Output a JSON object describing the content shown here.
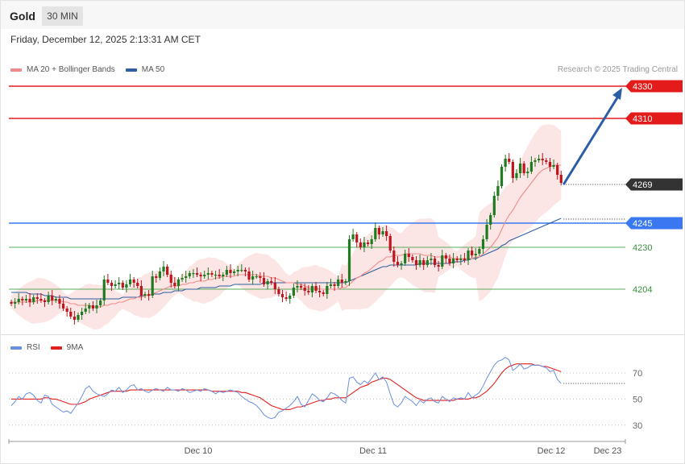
{
  "header": {
    "title": "Gold",
    "timeframe": "30 MIN",
    "datetime": "Friday, December 12, 2025 2:13:31 AM CET",
    "credit": "Research © 2025 Trading Central"
  },
  "colors": {
    "bullish": "#1e7b1e",
    "bearish": "#c0141c",
    "resistance": "#e31b1b",
    "pivot": "#3a78f2",
    "support": "#5aac5a",
    "bollinger": "#fbdcdc",
    "ma20": "#f08a8a",
    "ma50": "#2f5e9e",
    "last_price": "#333333",
    "arrow": "#2b5ea7",
    "rsi": "#6b8fe0",
    "rsi_ma": "#e21f1f"
  },
  "chart_data": [
    {
      "type": "candlestick",
      "title": "Gold",
      "timeframe": "30 MIN",
      "ylim": [
        4185,
        4340
      ],
      "x_tick_labels": [
        "Dec 10",
        "Dec 11",
        "Dec 12",
        "Dec 23"
      ],
      "legend": [
        {
          "name": "MA 20 + Bollinger Bands",
          "color": "#f08a8a"
        },
        {
          "name": "MA 50",
          "color": "#2f5e9e"
        }
      ],
      "legend_position": "top-left",
      "last_price": 4269,
      "levels": [
        {
          "label": "4330",
          "value": 4330,
          "kind": "resistance",
          "color": "#e31b1b"
        },
        {
          "label": "4310",
          "value": 4310,
          "kind": "resistance",
          "color": "#e31b1b"
        },
        {
          "label": "4245",
          "value": 4245,
          "kind": "pivot",
          "color": "#3a78f2"
        },
        {
          "label": "4230",
          "value": 4230,
          "kind": "support",
          "color": "#5aac5a"
        },
        {
          "label": "4204",
          "value": 4204,
          "kind": "support",
          "color": "#5aac5a"
        }
      ],
      "projection": {
        "from": 4269,
        "to": 4330,
        "color": "#2b5ea7"
      },
      "closes": [
        4195,
        4196,
        4198,
        4197,
        4198,
        4196,
        4199,
        4198,
        4197,
        4196,
        4200,
        4197,
        4198,
        4195,
        4192,
        4190,
        4187,
        4185,
        4188,
        4190,
        4192,
        4194,
        4192,
        4194,
        4197,
        4210,
        4208,
        4206,
        4207,
        4208,
        4205,
        4207,
        4210,
        4208,
        4206,
        4200,
        4201,
        4200,
        4212,
        4211,
        4215,
        4218,
        4213,
        4208,
        4206,
        4210,
        4211,
        4212,
        4214,
        4214,
        4213,
        4212,
        4213,
        4214,
        4213,
        4213,
        4212,
        4213,
        4216,
        4214,
        4215,
        4216,
        4216,
        4215,
        4210,
        4212,
        4212,
        4211,
        4207,
        4209,
        4208,
        4204,
        4201,
        4199,
        4198,
        4200,
        4205,
        4206,
        4205,
        4203,
        4202,
        4206,
        4203,
        4202,
        4201,
        4206,
        4207,
        4206,
        4210,
        4208,
        4209,
        4235,
        4238,
        4233,
        4230,
        4233,
        4232,
        4235,
        4242,
        4238,
        4240,
        4237,
        4228,
        4221,
        4219,
        4220,
        4226,
        4224,
        4222,
        4219,
        4222,
        4219,
        4222,
        4223,
        4219,
        4218,
        4225,
        4223,
        4220,
        4223,
        4222,
        4223,
        4222,
        4228,
        4225,
        4226,
        4229,
        4235,
        4244,
        4250,
        4262,
        4268,
        4280,
        4285,
        4283,
        4273,
        4276,
        4282,
        4276,
        4277,
        4283,
        4284,
        4285,
        4284,
        4283,
        4280,
        4281,
        4275,
        4270
      ],
      "ma20": [
        4196,
        4196,
        4196,
        4196,
        4196,
        4196,
        4196,
        4197,
        4197,
        4197,
        4197,
        4197,
        4197,
        4197,
        4196,
        4196,
        4195,
        4195,
        4194,
        4194,
        4194,
        4194,
        4193,
        4193,
        4193,
        4194,
        4194,
        4195,
        4195,
        4196,
        4196,
        4197,
        4198,
        4198,
        4199,
        4199,
        4200,
        4200,
        4201,
        4202,
        4203,
        4204,
        4205,
        4206,
        4206,
        4206,
        4207,
        4207,
        4208,
        4208,
        4209,
        4209,
        4209,
        4210,
        4210,
        4211,
        4211,
        4212,
        4212,
        4212,
        4212,
        4213,
        4213,
        4213,
        4213,
        4213,
        4213,
        4212,
        4212,
        4212,
        4211,
        4211,
        4210,
        4209,
        4208,
        4208,
        4208,
        4207,
        4207,
        4206,
        4205,
        4205,
        4205,
        4204,
        4204,
        4204,
        4204,
        4204,
        4204,
        4205,
        4205,
        4207,
        4209,
        4211,
        4212,
        4214,
        4215,
        4217,
        4219,
        4221,
        4222,
        4224,
        4224,
        4225,
        4225,
        4225,
        4226,
        4226,
        4226,
        4226,
        4226,
        4225,
        4225,
        4225,
        4224,
        4224,
        4224,
        4224,
        4224,
        4223,
        4223,
        4223,
        4223,
        4223,
        4223,
        4224,
        4224,
        4226,
        4228,
        4230,
        4233,
        4236,
        4241,
        4246,
        4250,
        4253,
        4257,
        4261,
        4264,
        4267,
        4270,
        4273,
        4276,
        4278,
        4279,
        4280,
        4281,
        4281,
        4281
      ],
      "ma50": [
        4202,
        4202,
        4202,
        4202,
        4202,
        4201,
        4201,
        4201,
        4201,
        4200,
        4200,
        4200,
        4199,
        4199,
        4199,
        4199,
        4198,
        4198,
        4198,
        4198,
        4198,
        4198,
        4198,
        4198,
        4198,
        4198,
        4198,
        4198,
        4198,
        4198,
        4199,
        4199,
        4199,
        4199,
        4199,
        4200,
        4200,
        4200,
        4201,
        4201,
        4201,
        4202,
        4202,
        4202,
        4203,
        4203,
        4203,
        4204,
        4204,
        4204,
        4204,
        4205,
        4205,
        4205,
        4205,
        4205,
        4206,
        4206,
        4206,
        4206,
        4207,
        4207,
        4207,
        4207,
        4207,
        4207,
        4207,
        4207,
        4208,
        4208,
        4208,
        4208,
        4208,
        4208,
        4208,
        4208,
        4208,
        4208,
        4208,
        4208,
        4208,
        4208,
        4208,
        4208,
        4208,
        4208,
        4208,
        4208,
        4208,
        4208,
        4208,
        4209,
        4210,
        4211,
        4212,
        4213,
        4214,
        4215,
        4216,
        4217,
        4218,
        4218,
        4219,
        4219,
        4219,
        4219,
        4219,
        4219,
        4219,
        4219,
        4220,
        4220,
        4220,
        4220,
        4220,
        4220,
        4220,
        4220,
        4220,
        4221,
        4221,
        4221,
        4222,
        4222,
        4223,
        4223,
        4224,
        4225,
        4226,
        4227,
        4228,
        4229,
        4231,
        4232,
        4234,
        4235,
        4236,
        4237,
        4238,
        4239,
        4240,
        4241,
        4242,
        4243,
        4244,
        4245,
        4246,
        4247,
        4248
      ]
    },
    {
      "type": "line",
      "title": "RSI",
      "ylim": [
        20,
        90
      ],
      "y_ticks": [
        30,
        50,
        70
      ],
      "legend": [
        {
          "name": "RSI",
          "color": "#6b8fe0"
        },
        {
          "name": "9MA",
          "color": "#e21f1f"
        }
      ],
      "legend_position": "top-left",
      "series": [
        {
          "name": "RSI",
          "values": [
            45,
            48,
            52,
            50,
            54,
            55,
            53,
            49,
            47,
            53,
            52,
            46,
            44,
            42,
            40,
            41,
            39,
            43,
            47,
            52,
            58,
            60,
            56,
            54,
            53,
            52,
            54,
            57,
            56,
            59,
            55,
            57,
            60,
            61,
            57,
            58,
            56,
            55,
            57,
            58,
            57,
            56,
            59,
            57,
            57,
            56,
            58,
            57,
            55,
            56,
            57,
            56,
            58,
            57,
            56,
            54,
            56,
            55,
            56,
            57,
            56,
            55,
            52,
            50,
            48,
            47,
            45,
            42,
            38,
            36,
            35,
            36,
            40,
            41,
            43,
            45,
            48,
            52,
            46,
            44,
            49,
            54,
            52,
            49,
            48,
            51,
            55,
            54,
            52,
            49,
            47,
            66,
            67,
            63,
            61,
            64,
            62,
            66,
            70,
            65,
            67,
            63,
            54,
            46,
            44,
            47,
            52,
            50,
            48,
            45,
            49,
            47,
            50,
            51,
            48,
            47,
            52,
            50,
            48,
            51,
            50,
            51,
            50,
            55,
            51,
            53,
            55,
            60,
            66,
            71,
            76,
            79,
            80,
            82,
            80,
            72,
            74,
            77,
            73,
            74,
            76,
            76,
            76,
            75,
            74,
            71,
            72,
            65,
            62
          ]
        },
        {
          "name": "9MA",
          "values": [
            50,
            50,
            50,
            50,
            50,
            50,
            50,
            50,
            50,
            51,
            51,
            50,
            50,
            49,
            48,
            47,
            46,
            46,
            46,
            47,
            48,
            50,
            51,
            52,
            53,
            54,
            55,
            56,
            56,
            56,
            56,
            56,
            57,
            57,
            57,
            57,
            57,
            57,
            57,
            57,
            57,
            57,
            57,
            57,
            57,
            57,
            57,
            57,
            57,
            57,
            57,
            57,
            57,
            57,
            56,
            56,
            56,
            56,
            56,
            56,
            56,
            56,
            55,
            55,
            54,
            53,
            52,
            51,
            49,
            47,
            45,
            44,
            43,
            42,
            42,
            42,
            43,
            44,
            44,
            45,
            46,
            47,
            48,
            49,
            49,
            50,
            50,
            51,
            51,
            51,
            51,
            53,
            55,
            57,
            59,
            60,
            61,
            63,
            64,
            65,
            66,
            66,
            65,
            63,
            61,
            59,
            57,
            55,
            53,
            51,
            50,
            49,
            49,
            49,
            49,
            49,
            49,
            49,
            49,
            49,
            50,
            50,
            50,
            50,
            51,
            51,
            52,
            54,
            56,
            59,
            62,
            66,
            70,
            73,
            75,
            76,
            77,
            77,
            77,
            77,
            77,
            76,
            76,
            75,
            75,
            74,
            73,
            72,
            71
          ]
        }
      ],
      "x_tick_labels": [
        "Dec 10",
        "Dec 11",
        "Dec 12",
        "Dec 23"
      ]
    }
  ]
}
